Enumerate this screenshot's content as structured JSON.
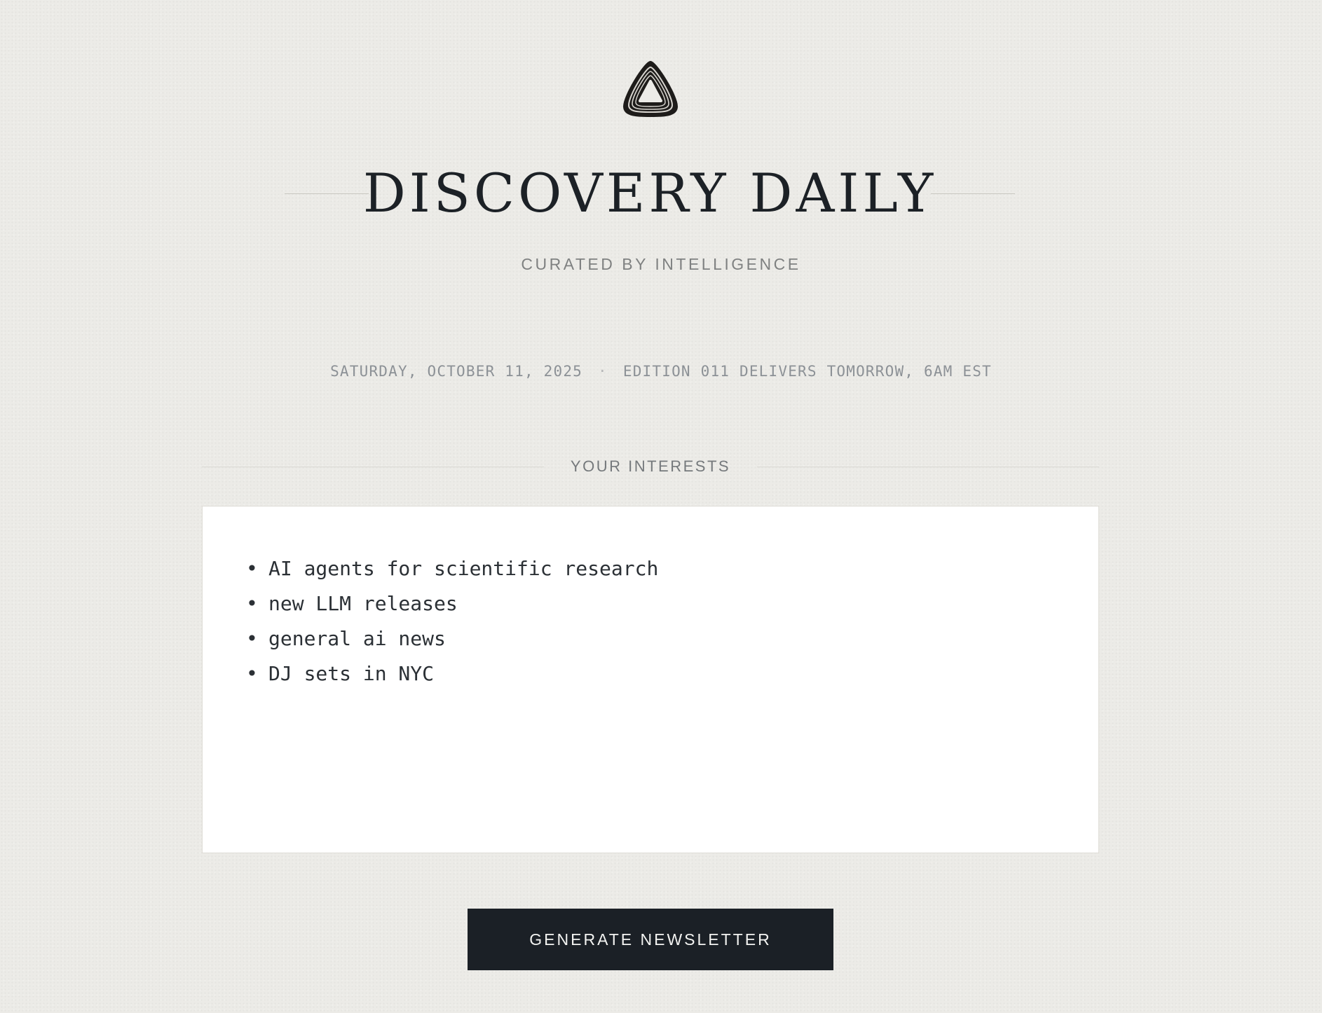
{
  "header": {
    "logo_icon": "triangle-knot-logo-icon",
    "title": "DISCOVERY DAILY",
    "subtitle": "CURATED BY INTELLIGENCE"
  },
  "meta": {
    "date": "SATURDAY, OCTOBER 11, 2025",
    "separator": "·",
    "edition": "EDITION 011 DELIVERS TOMORROW, 6AM EST"
  },
  "interests": {
    "label": "YOUR INTERESTS",
    "bullet": "•",
    "items": [
      "AI agents for scientific research",
      "new LLM releases",
      "general ai news",
      "DJ sets in NYC"
    ]
  },
  "actions": {
    "generate_label": "GENERATE NEWSLETTER"
  },
  "colors": {
    "background": "#ecebe7",
    "ink": "#1c2126",
    "button": "#1b2026",
    "muted": "#7f8181"
  }
}
